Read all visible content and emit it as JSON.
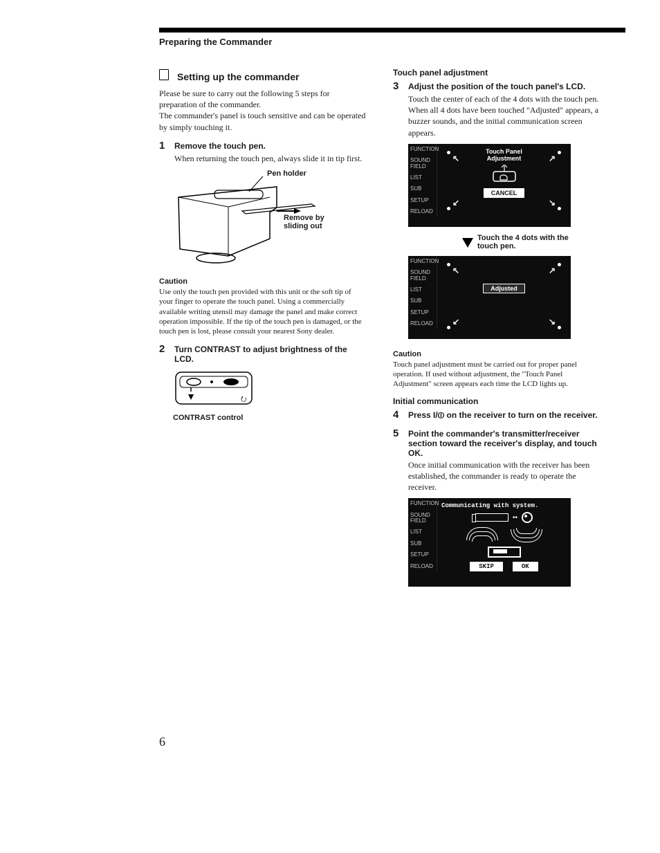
{
  "section_header": "Preparing the Commander",
  "left": {
    "main_heading": "Setting up the commander",
    "intro": "Please be sure to carry out the following 5 steps for preparation of the commander.\nThe commander's panel is touch sensitive and can be operated by simply touching it.",
    "step1": {
      "num": "1",
      "title": "Remove the touch pen.",
      "body": "When returning the touch pen, always slide it in tip first.",
      "label_pen_holder": "Pen holder",
      "label_remove": "Remove by sliding out"
    },
    "caution_heading": "Caution",
    "caution_body": "Use only the touch pen provided with this unit or the soft tip of your finger to operate the touch panel. Using a commercially available writing utensil may damage the panel and make correct operation impossible. If the tip of the touch pen is damaged, or the touch pen is lost, please consult your nearest Sony dealer.",
    "step2": {
      "num": "2",
      "title": "Turn CONTRAST to adjust brightness of the LCD.",
      "contrast_label": "CONTRAST control"
    }
  },
  "right": {
    "touch_heading": "Touch panel adjustment",
    "step3": {
      "num": "3",
      "title": "Adjust the position of the touch panel's LCD.",
      "body": "Touch the center of each of the 4 dots with the touch pen. When all 4 dots have been touched \"Adjusted\" appears, a buzzer sounds, and the initial communication screen appears."
    },
    "lcd_side_items": [
      "FUNCTION",
      "SOUND FIELD",
      "LIST",
      "SUB",
      "SETUP",
      "RELOAD"
    ],
    "lcd1": {
      "title_line1": "Touch Panel",
      "title_line2": "Adjustment",
      "cancel": "CANCEL"
    },
    "lcd1_caption": "Touch the 4 dots with the touch pen.",
    "lcd2": {
      "adjusted": "Adjusted"
    },
    "caution2_heading": "Caution",
    "caution2_body": "Touch panel adjustment must be carried out for proper panel operation. If used without adjustment, the \"Touch Panel Adjustment\" screen appears each time the LCD lights up.",
    "initial_heading": "Initial communication",
    "step4": {
      "num": "4",
      "title": "Press I/⏼ on the receiver to turn on the receiver."
    },
    "step5": {
      "num": "5",
      "title": "Point the commander's transmitter/receiver section toward the receiver's display, and touch OK.",
      "body": "Once initial communication with the receiver has been established, the commander is ready to operate the receiver."
    },
    "lcd3": {
      "status": "Communicating with system.",
      "skip": "SKIP",
      "ok": "OK"
    }
  },
  "page_number": "6"
}
